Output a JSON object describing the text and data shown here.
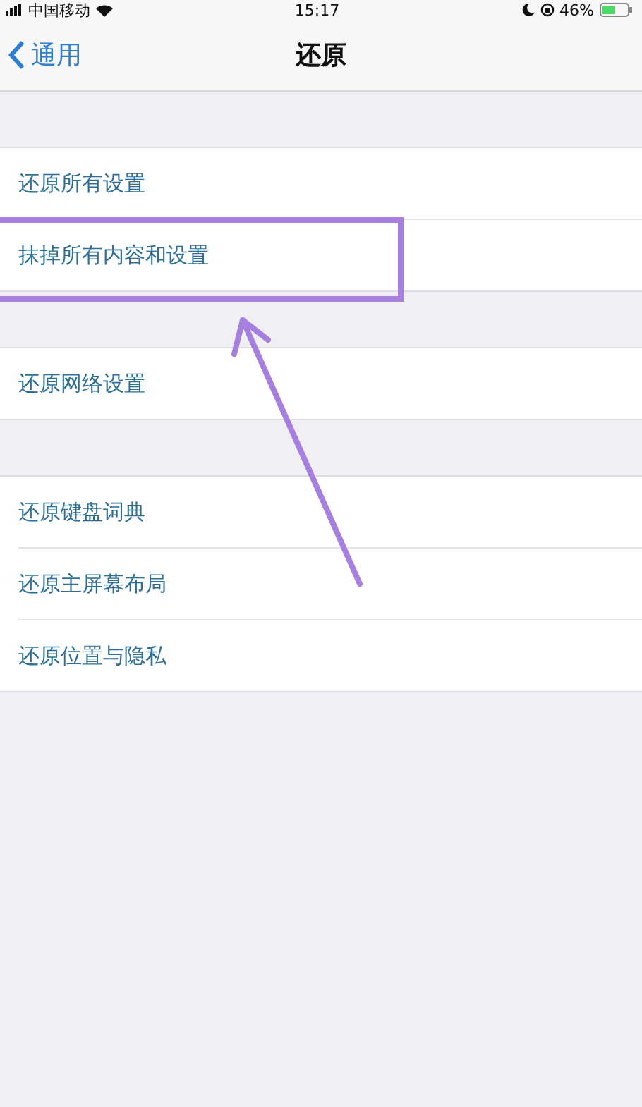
{
  "status_bar": {
    "carrier": "中国移动",
    "time": "15:17",
    "battery": "46%"
  },
  "nav": {
    "back": "通用",
    "title": "还原"
  },
  "groups": [
    {
      "items": [
        {
          "label": "还原所有设置",
          "highlighted": false
        },
        {
          "label": "抹掉所有内容和设置",
          "highlighted": true
        }
      ]
    },
    {
      "items": [
        {
          "label": "还原网络设置",
          "highlighted": false
        }
      ]
    },
    {
      "items": [
        {
          "label": "还原键盘词典",
          "highlighted": false
        },
        {
          "label": "还原主屏幕布局",
          "highlighted": false
        },
        {
          "label": "还原位置与隐私",
          "highlighted": false
        }
      ]
    }
  ]
}
